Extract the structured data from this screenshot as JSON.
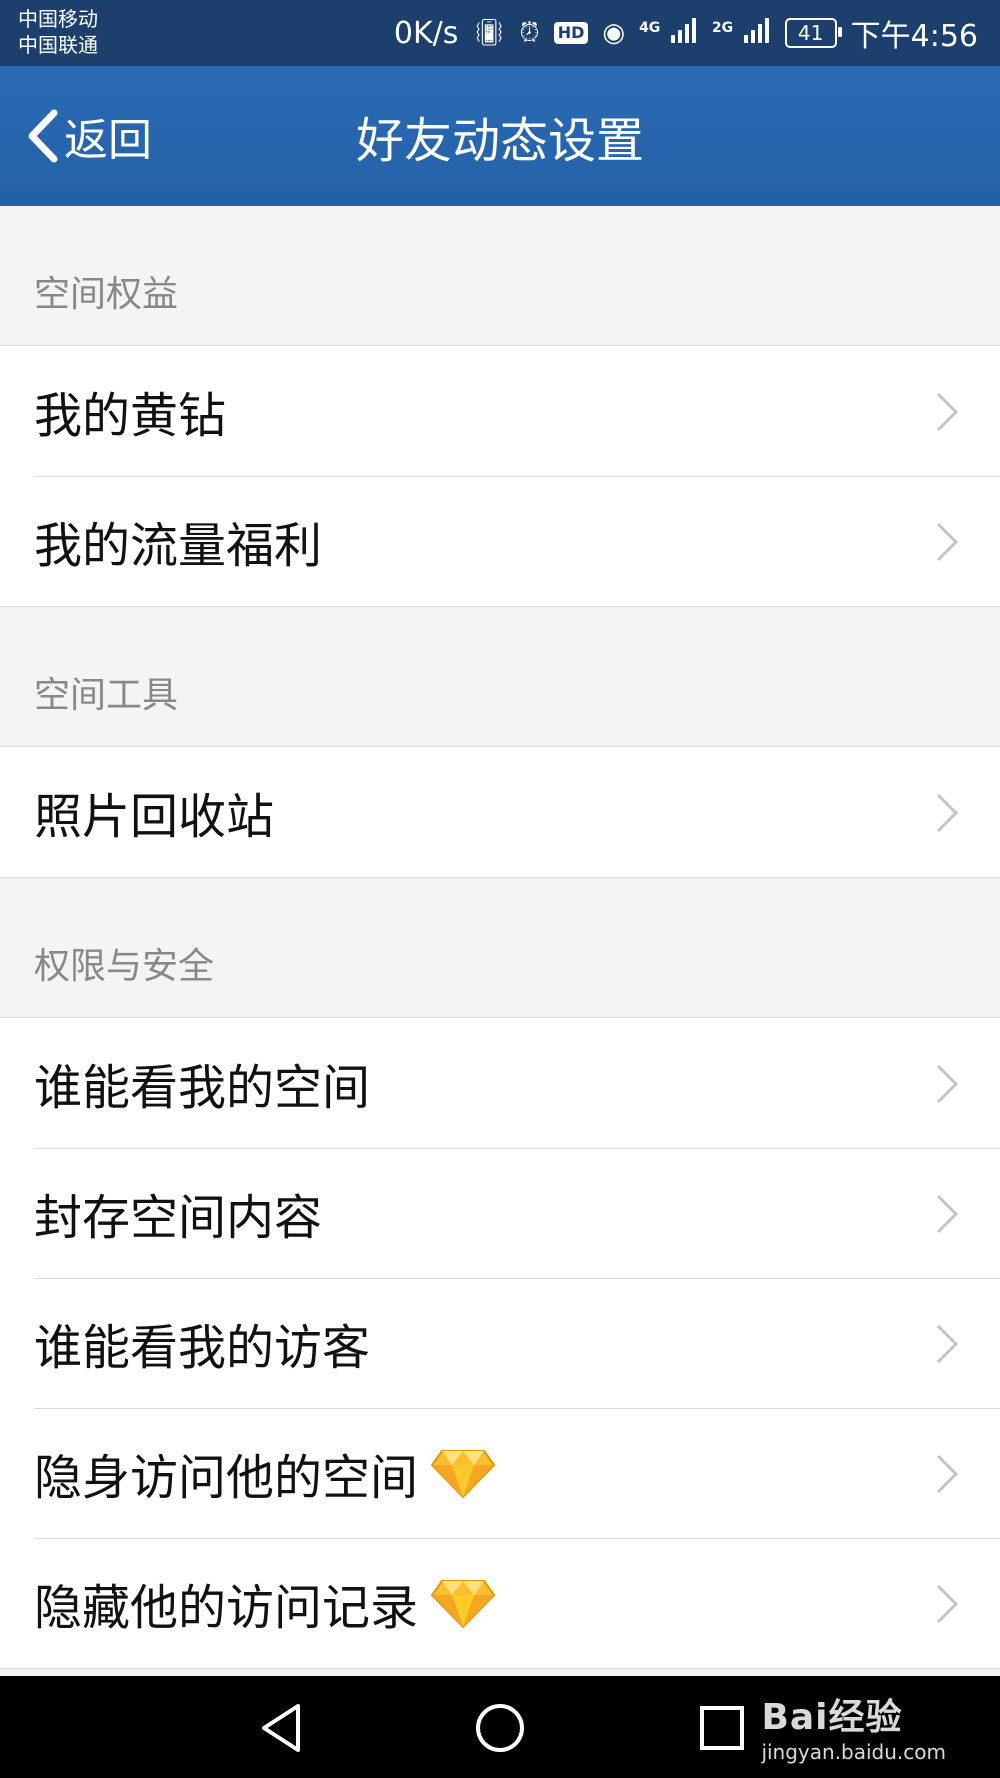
{
  "status_bar": {
    "carrier_1": "中国移动",
    "carrier_2": "中国联通",
    "net_speed": "0K/s",
    "hd_label": "HD",
    "net_4g": "4G",
    "net_2g": "2G",
    "battery": "41",
    "time": "下午4:56"
  },
  "header": {
    "back_label": "返回",
    "title": "好友动态设置"
  },
  "sections": [
    {
      "title": "空间权益",
      "items": [
        {
          "label": "我的黄钻",
          "vip": false
        },
        {
          "label": "我的流量福利",
          "vip": false
        }
      ]
    },
    {
      "title": "空间工具",
      "items": [
        {
          "label": "照片回收站",
          "vip": false
        }
      ]
    },
    {
      "title": "权限与安全",
      "items": [
        {
          "label": "谁能看我的空间",
          "vip": false
        },
        {
          "label": "封存空间内容",
          "vip": false
        },
        {
          "label": "谁能看我的访客",
          "vip": false
        },
        {
          "label": "隐身访问他的空间",
          "vip": true
        },
        {
          "label": "隐藏他的访问记录",
          "vip": true
        }
      ]
    }
  ],
  "watermark": {
    "brand": "Bai经验",
    "url": "jingyan.baidu.com"
  },
  "colors": {
    "title_bar": "#2461a8",
    "status_bar": "#1d3f6e",
    "vip_diamond": "#f5a623"
  }
}
